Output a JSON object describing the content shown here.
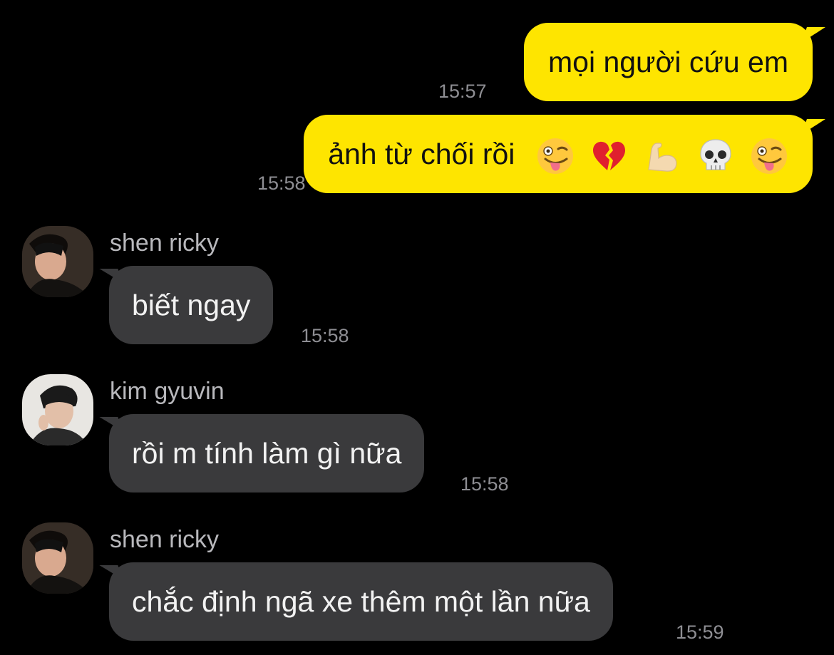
{
  "colors": {
    "background": "#000000",
    "outgoing_bubble": "#FEE500",
    "incoming_bubble": "#3A3A3C",
    "timestamp": "#8E8E93"
  },
  "messages": [
    {
      "direction": "outgoing",
      "text": "mọi người cứu em",
      "time": "15:57"
    },
    {
      "direction": "outgoing",
      "text": "ảnh từ chối rồi",
      "emojis": [
        "zany-face-icon",
        "broken-heart-icon",
        "flexed-biceps-icon",
        "skull-icon",
        "zany-face-icon"
      ],
      "time": "15:58"
    },
    {
      "direction": "incoming",
      "sender": "shen ricky",
      "avatar": "avatar-shen-ricky",
      "text": "biết ngay",
      "time": "15:58"
    },
    {
      "direction": "incoming",
      "sender": "kim gyuvin",
      "avatar": "avatar-kim-gyuvin",
      "text": "rồi m tính làm gì nữa",
      "time": "15:58"
    },
    {
      "direction": "incoming",
      "sender": "shen ricky",
      "avatar": "avatar-shen-ricky",
      "text": "chắc định ngã xe thêm một lần nữa",
      "time": "15:59"
    }
  ]
}
